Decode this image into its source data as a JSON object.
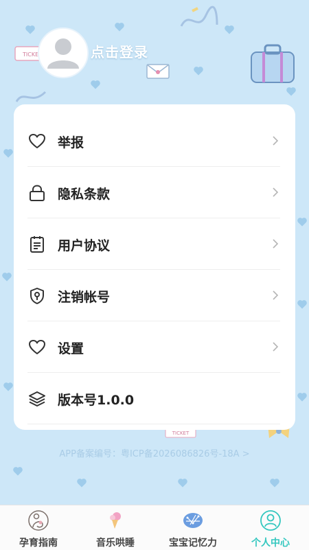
{
  "profile": {
    "login_text": "点击登录"
  },
  "menu": [
    {
      "label": "举报",
      "icon": "heart-icon"
    },
    {
      "label": "隐私条款",
      "icon": "lock-icon"
    },
    {
      "label": "用户协议",
      "icon": "clipboard-icon"
    },
    {
      "label": "注销帐号",
      "icon": "shield-icon"
    },
    {
      "label": "设置",
      "icon": "heart-icon"
    },
    {
      "label": "版本号1.0.0",
      "icon": "layers-icon"
    }
  ],
  "footer": {
    "icp": "APP备案编号：粤ICP备2026086826号-18A  >"
  },
  "tabs": [
    {
      "label": "孕育指南",
      "icon": "mother-baby-icon",
      "active": false
    },
    {
      "label": "音乐哄睡",
      "icon": "ice-cream-icon",
      "active": false
    },
    {
      "label": "宝宝记忆力",
      "icon": "brain-icon",
      "active": false
    },
    {
      "label": "个人中心",
      "icon": "user-icon",
      "active": true
    }
  ],
  "colors": {
    "accent": "#33c7bf",
    "background": "#cde7f8",
    "card": "#ffffff"
  }
}
